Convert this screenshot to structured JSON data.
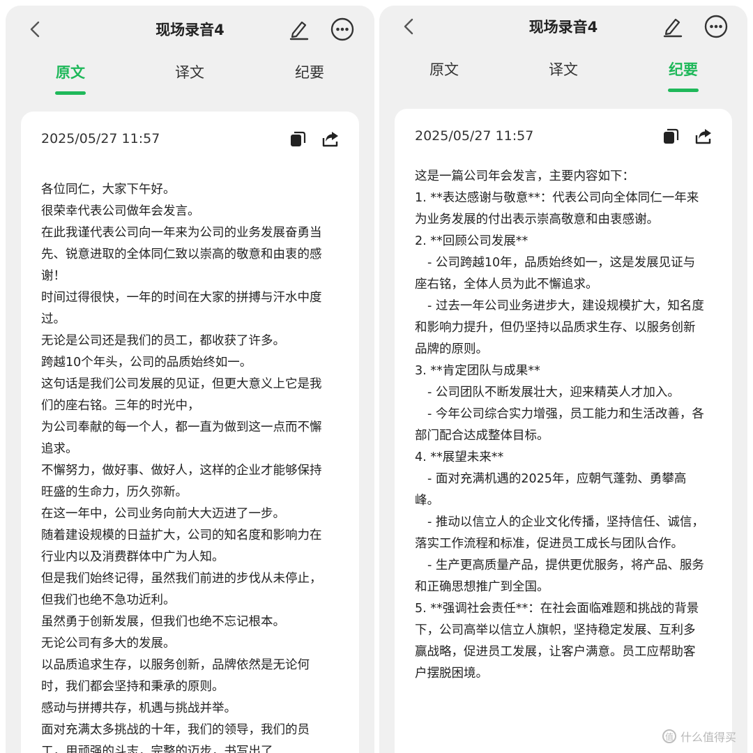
{
  "left": {
    "title": "现场录音4",
    "tabs": [
      "原文",
      "译文",
      "纪要"
    ],
    "active_tab": 0,
    "date": "2025/05/27 11:57",
    "lines": [
      "各位同仁，大家下午好。",
      "很荣幸代表公司做年会发言。",
      "在此我谨代表公司向一年来为公司的业务发展奋勇当先、锐意进取的全体同仁致以崇高的敬意和由衷的感谢！",
      "时间过得很快，一年的时间在大家的拼搏与汗水中度过。",
      "无论是公司还是我们的员工，都收获了许多。",
      "跨越10个年头，公司的品质始终如一。",
      "这句话是我们公司发展的见证，但更大意义上它是我们的座右铭。三年的时光中，",
      "为公司奉献的每一个人，都一直为做到这一点而不懈追求。",
      "不懈努力，做好事、做好人，这样的企业才能够保持旺盛的生命力，历久弥新。",
      "在这一年中，公司业务向前大大迈进了一步。",
      "随着建设规模的日益扩大，公司的知名度和影响力在行业内以及消费群体中广为人知。",
      "但是我们始终记得，虽然我们前进的步伐从未停止，但我们也绝不急功近利。",
      "虽然勇于创新发展，但我们也绝不忘记根本。",
      "无论公司有多大的发展。",
      "以品质追求生存，以服务创新，品牌依然是无论何时，我们都会坚持和秉承的原则。",
      "感动与拼搏共存，机遇与挑战并举。",
      "面对充满太多挑战的十年，我们的领导，我们的员工，用顽强的斗志，完整的迈步，书写出了"
    ]
  },
  "right": {
    "title": "现场录音4",
    "tabs": [
      "原文",
      "译文",
      "纪要"
    ],
    "active_tab": 2,
    "date": "2025/05/27 11:57",
    "lines": [
      {
        "t": "这是一篇公司年会发言，主要内容如下：",
        "sub": false
      },
      {
        "t": "1. **表达感谢与敬意**：代表公司向全体同仁一年来为业务发展的付出表示崇高敬意和由衷感谢。",
        "sub": false
      },
      {
        "t": "2. **回顾公司发展**",
        "sub": false
      },
      {
        "t": "- 公司跨越10年，品质始终如一，这是发展见证与座右铭，全体人员为此不懈追求。",
        "sub": true
      },
      {
        "t": "- 过去一年公司业务进步大，建设规模扩大，知名度和影响力提升，但仍坚持以品质求生存、以服务创新品牌的原则。",
        "sub": true
      },
      {
        "t": "3. **肯定团队与成果**",
        "sub": false
      },
      {
        "t": "- 公司团队不断发展壮大，迎来精英人才加入。",
        "sub": true
      },
      {
        "t": "- 今年公司综合实力增强，员工能力和生活改善，各部门配合达成整体目标。",
        "sub": true
      },
      {
        "t": "4. **展望未来**",
        "sub": false
      },
      {
        "t": "- 面对充满机遇的2025年，应朝气蓬勃、勇攀高峰。",
        "sub": true
      },
      {
        "t": "- 推动以信立人的企业文化传播，坚持信任、诚信，落实工作流程和标准，促进员工成长与团队合作。",
        "sub": true
      },
      {
        "t": "- 生产更高质量产品，提供更优服务，将产品、服务和正确思想推广到全国。",
        "sub": true
      },
      {
        "t": "5. **强调社会责任**：在社会面临难题和挑战的背景下，公司高举以信立人旗帜，坚持稳定发展、互利多赢战略，促进员工发展，让客户满意。员工应帮助客户摆脱困境。",
        "sub": false
      }
    ]
  },
  "watermark": "什么值得买",
  "accent": "#1fb85a"
}
